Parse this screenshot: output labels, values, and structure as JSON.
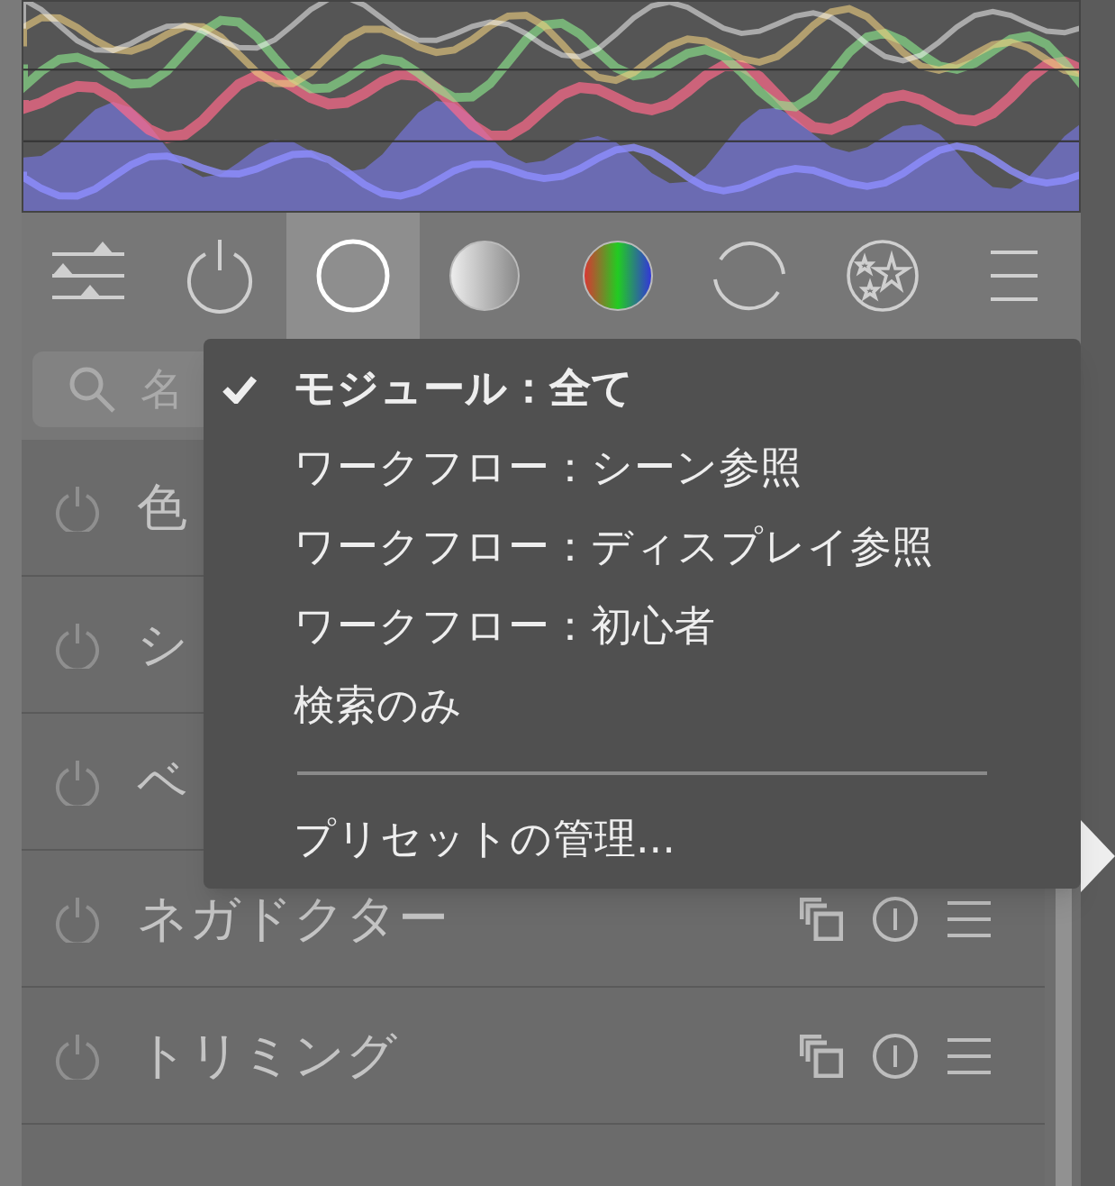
{
  "tabs": [
    {
      "kind": "sliders",
      "selected": false
    },
    {
      "kind": "power",
      "selected": false
    },
    {
      "kind": "ring",
      "selected": true
    },
    {
      "kind": "gradient",
      "selected": false
    },
    {
      "kind": "spectrum",
      "selected": false
    },
    {
      "kind": "cycle",
      "selected": false
    },
    {
      "kind": "stars",
      "selected": false
    },
    {
      "kind": "lines",
      "selected": false
    }
  ],
  "search": {
    "placeholder": "名"
  },
  "modules": [
    {
      "name": "色"
    },
    {
      "name": "シ"
    },
    {
      "name": "ベ"
    },
    {
      "name": "ネガドクター"
    },
    {
      "name": "トリミング"
    }
  ],
  "menu": {
    "items": [
      {
        "kind": "option",
        "label": "モジュール：全て",
        "selected": true
      },
      {
        "kind": "option",
        "label": "ワークフロー：シーン参照",
        "selected": false
      },
      {
        "kind": "option",
        "label": "ワークフロー：ディスプレイ参照",
        "selected": false
      },
      {
        "kind": "option",
        "label": "ワークフロー：初心者",
        "selected": false
      },
      {
        "kind": "option",
        "label": "検索のみ",
        "selected": false
      },
      {
        "kind": "separator"
      },
      {
        "kind": "action",
        "label": "プリセットの管理..."
      }
    ]
  }
}
